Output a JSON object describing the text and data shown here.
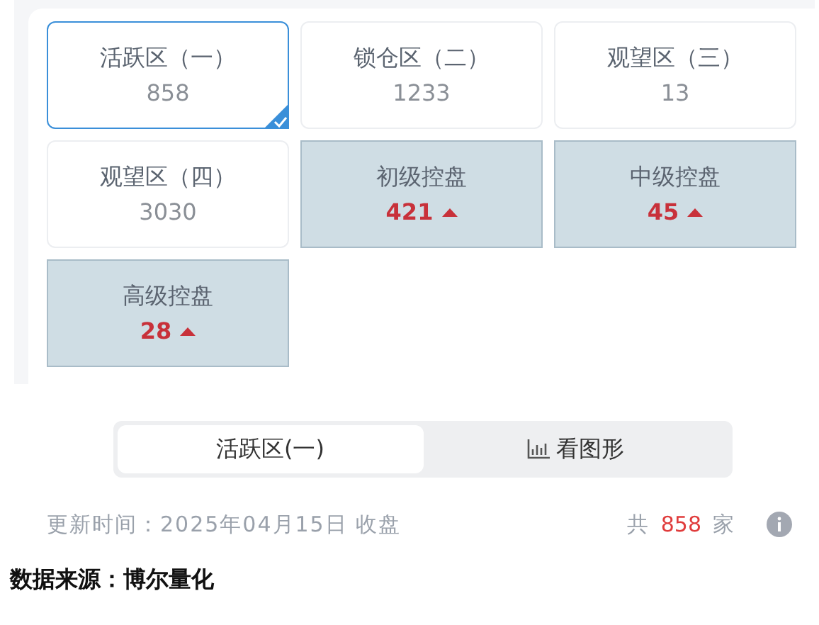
{
  "cards": [
    {
      "kind": "zone",
      "label": "活跃区（一）",
      "count": "858",
      "selected": true
    },
    {
      "kind": "zone",
      "label": "锁仓区（二）",
      "count": "1233",
      "selected": false
    },
    {
      "kind": "zone",
      "label": "观望区（三）",
      "count": "13",
      "selected": false
    },
    {
      "kind": "zone",
      "label": "观望区（四）",
      "count": "3030",
      "selected": false
    },
    {
      "kind": "control",
      "label": "初级控盘",
      "count": "421",
      "selected": false
    },
    {
      "kind": "control",
      "label": "中级控盘",
      "count": "45",
      "selected": false
    },
    {
      "kind": "control",
      "label": "高级控盘",
      "count": "28",
      "selected": false
    }
  ],
  "segments": [
    {
      "label": "活跃区(一)",
      "selected": true
    },
    {
      "label": "看图形",
      "selected": false
    }
  ],
  "update": {
    "label": "更新时间：",
    "date": "2025年04月15日 收盘"
  },
  "total": {
    "prefix": "共",
    "count": "858",
    "suffix": "家"
  },
  "source": "数据来源：博尔量化"
}
